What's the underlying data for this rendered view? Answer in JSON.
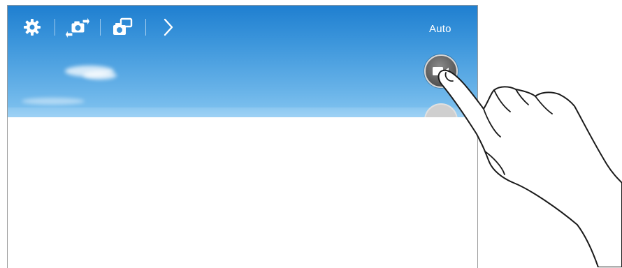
{
  "camera": {
    "toolbar": {
      "icons": [
        "settings-icon",
        "switch-camera-icon",
        "dual-camera-icon",
        "expand-chevron-icon"
      ]
    },
    "mode_label": "Auto",
    "record_button": {
      "icon": "video-record-icon"
    },
    "shutter_button": {
      "icon": "camera-shutter-icon"
    },
    "gesture": {
      "icon": "finger-tap-icon"
    },
    "colors": {
      "sky_top": "#1f7fd0",
      "sky_bottom": "#84c5f0",
      "button_dark": "#5c5c5c"
    }
  }
}
